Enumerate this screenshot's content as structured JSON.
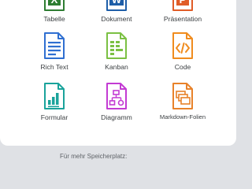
{
  "tiles": [
    {
      "label": "Tabelle",
      "icon": "spreadsheet-icon",
      "color": "#2e7d32",
      "letter": "X"
    },
    {
      "label": "Dokument",
      "icon": "document-icon",
      "color": "#1e5ea8",
      "letter": "W"
    },
    {
      "label": "Präsentation",
      "icon": "presentation-icon",
      "color": "#e05c27",
      "letter": "P"
    },
    {
      "label": "Rich Text",
      "icon": "rich-text-icon",
      "color": "#2f6fd1"
    },
    {
      "label": "Kanban",
      "icon": "kanban-icon",
      "color": "#7bc043"
    },
    {
      "label": "Code",
      "icon": "code-icon",
      "color": "#f08c1e"
    },
    {
      "label": "Formular",
      "icon": "form-icon",
      "color": "#1aa39b"
    },
    {
      "label": "Diagramm",
      "icon": "diagram-icon",
      "color": "#c33bd3"
    },
    {
      "label": "Markdown-Folien",
      "icon": "markdown-slides-icon",
      "color": "#e8822a"
    }
  ],
  "footer": {
    "text": "Für mehr Speicherplatz:"
  }
}
